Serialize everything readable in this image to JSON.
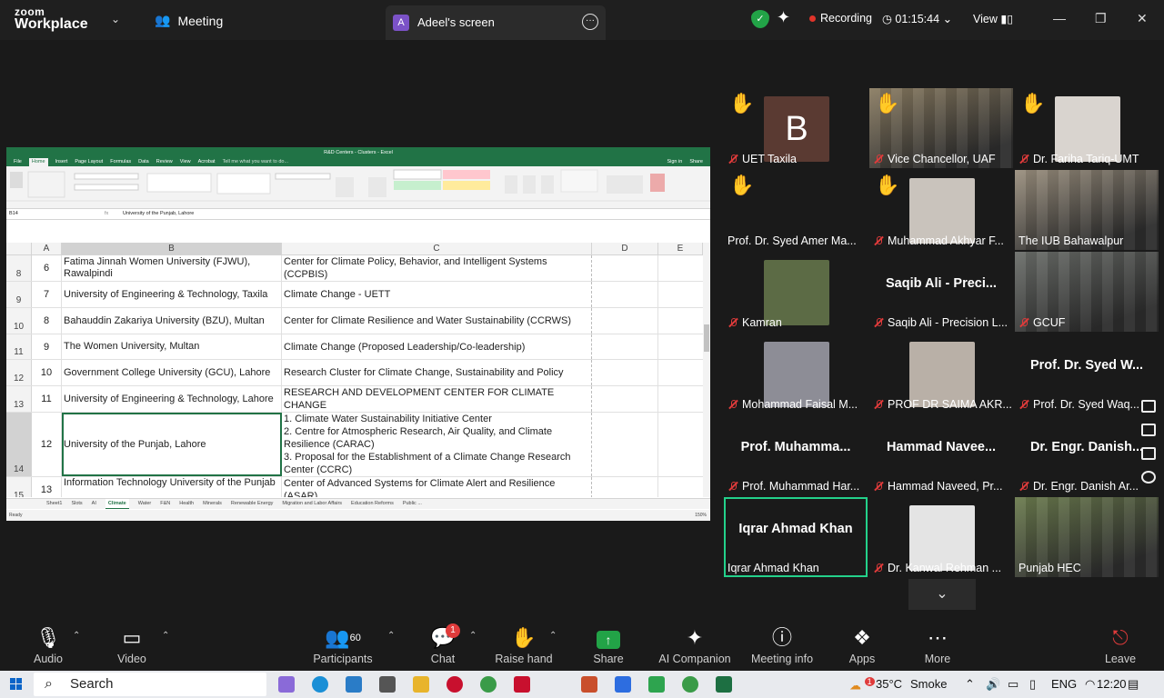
{
  "topbar": {
    "brand_line1": "zoom",
    "brand_line2": "Workplace",
    "meeting_label": "Meeting",
    "share_tab_initial": "A",
    "share_tab_name": "Adeel's screen",
    "recording_label": "Recording",
    "timer": "01:15:44",
    "view_label": "View"
  },
  "excel": {
    "title": "R&D Centers - Clusters - Excel",
    "menu": [
      "File",
      "Home",
      "Insert",
      "Page Layout",
      "Formulas",
      "Data",
      "Review",
      "View",
      "Acrobat"
    ],
    "tell_me": "Tell me what you want to do...",
    "sign_in": "Sign in",
    "share": "Share",
    "name_box": "B14",
    "formula": "University of the Punjab, Lahore",
    "columns": [
      "A",
      "B",
      "C",
      "D",
      "E"
    ],
    "rows": [
      {
        "rownum": "8",
        "a": "6",
        "b": "Fatima Jinnah Women University (FJWU), Rawalpindi",
        "c": "Center for Climate Policy, Behavior, and Intelligent Systems (CCPBIS)"
      },
      {
        "rownum": "9",
        "a": "7",
        "b": "University of Engineering & Technology, Taxila",
        "c": "Climate Change - UETT"
      },
      {
        "rownum": "10",
        "a": "8",
        "b": "Bahauddin Zakariya University (BZU), Multan",
        "c": "Center for Climate Resilience and Water Sustainability (CCRWS)"
      },
      {
        "rownum": "11",
        "a": "9",
        "b": "The Women University, Multan",
        "c": "Climate Change (Proposed Leadership/Co-leadership)"
      },
      {
        "rownum": "12",
        "a": "10",
        "b": "Government College University (GCU), Lahore",
        "c": "Research Cluster for Climate Change, Sustainability and Policy"
      },
      {
        "rownum": "13",
        "a": "11",
        "b": "University of Engineering & Technology, Lahore",
        "c": "RESEARCH AND DEVELOPMENT CENTER FOR CLIMATE CHANGE"
      },
      {
        "rownum": "14",
        "a": "12",
        "b": "University of the Punjab, Lahore",
        "c1": "1. Climate Water Sustainability Initiative Center",
        "c2": "2. Centre for Atmospheric Research, Air Quality, and Climate Resilience (CARAC)",
        "c3": "3. Proposal for the Establishment of a Climate Change Research Center (CCRC)"
      },
      {
        "rownum": "15",
        "a": "13",
        "b": "Information Technology University of the Punjab",
        "c": "Center of Advanced Systems for Climate Alert and Resilience (ASAR)"
      }
    ],
    "sheet_tabs": [
      "Sheet1",
      "Slots",
      "AI",
      "Climate",
      "Water",
      "F&N",
      "Health",
      "Minerals",
      "Renewable Energy",
      "Migration and Labor Affairs",
      "Education Reforms",
      "Public ..."
    ],
    "active_sheet": "Climate",
    "status": "Ready",
    "zoom": "150%"
  },
  "participants": [
    {
      "display": "B",
      "name": "UET Taxila",
      "hand": true,
      "muted": true,
      "kind": "avatar",
      "color": "#5a3a32"
    },
    {
      "display": "",
      "name": "Vice Chancellor, UAF",
      "hand": true,
      "muted": true,
      "kind": "video",
      "color": "#8a7c62"
    },
    {
      "display": "",
      "name": "Dr. Fariha Tariq-UMT",
      "hand": true,
      "muted": true,
      "kind": "photo",
      "color": "#d9d4cf"
    },
    {
      "display": "",
      "name": "Prof. Dr. Syed Amer Ma...",
      "hand": true,
      "muted": false,
      "kind": "none",
      "color": "#1a1a1a"
    },
    {
      "display": "",
      "name": "Muhammad Akhyar F...",
      "hand": true,
      "muted": true,
      "kind": "photo",
      "color": "#c9c3bc"
    },
    {
      "display": "",
      "name": "The IUB Bahawalpur",
      "hand": false,
      "muted": false,
      "kind": "video",
      "color": "#9a8f7e"
    },
    {
      "display": "",
      "name": "Kamran",
      "hand": false,
      "muted": true,
      "kind": "photo",
      "color": "#5c6b45"
    },
    {
      "display": "Saqib Ali - Preci...",
      "name": "Saqib Ali - Precision L...",
      "hand": false,
      "muted": true,
      "kind": "text",
      "color": "#1a1a1a"
    },
    {
      "display": "",
      "name": "GCUF",
      "hand": false,
      "muted": true,
      "kind": "video",
      "color": "#6b6e6a"
    },
    {
      "display": "",
      "name": "Mohammad Faisal M...",
      "hand": false,
      "muted": true,
      "kind": "photo",
      "color": "#8d8d96"
    },
    {
      "display": "",
      "name": "PROF DR SAIMA AKR...",
      "hand": false,
      "muted": true,
      "kind": "photo",
      "color": "#b9b0a7"
    },
    {
      "display": "Prof. Dr. Syed W...",
      "name": "Prof. Dr. Syed Waq...",
      "hand": false,
      "muted": true,
      "kind": "text",
      "color": "#1a1a1a"
    },
    {
      "display": "Prof. Muhamma...",
      "name": "Prof. Muhammad Har...",
      "hand": false,
      "muted": true,
      "kind": "text",
      "color": "#1a1a1a"
    },
    {
      "display": "Hammad Navee...",
      "name": "Hammad Naveed, Pr...",
      "hand": false,
      "muted": true,
      "kind": "text",
      "color": "#1a1a1a"
    },
    {
      "display": "Dr. Engr. Danish...",
      "name": "Dr. Engr. Danish Ar...",
      "hand": false,
      "muted": true,
      "kind": "text",
      "color": "#1a1a1a"
    },
    {
      "display": "Iqrar Ahmad Khan",
      "name": "Iqrar Ahmad Khan",
      "hand": false,
      "muted": false,
      "kind": "text",
      "color": "#1a1a1a",
      "speaking": true
    },
    {
      "display": "",
      "name": "Dr. Kanwal Rehman ...",
      "hand": false,
      "muted": true,
      "kind": "photo",
      "color": "#e4e4e4"
    },
    {
      "display": "",
      "name": "Punjab HEC",
      "hand": false,
      "muted": false,
      "kind": "video",
      "color": "#6b7b4e"
    }
  ],
  "controls": {
    "audio": "Audio",
    "video": "Video",
    "participants": "Participants",
    "participants_count": "60",
    "chat": "Chat",
    "chat_badge": "1",
    "raise_hand": "Raise hand",
    "share": "Share",
    "ai_companion": "AI Companion",
    "meeting_info": "Meeting info",
    "apps": "Apps",
    "more": "More",
    "leave": "Leave"
  },
  "taskbar": {
    "search_placeholder": "Search",
    "weather_badge": "1",
    "temperature": "35°C",
    "weather": "Smoke",
    "language": "ENG",
    "time": "12:20"
  }
}
